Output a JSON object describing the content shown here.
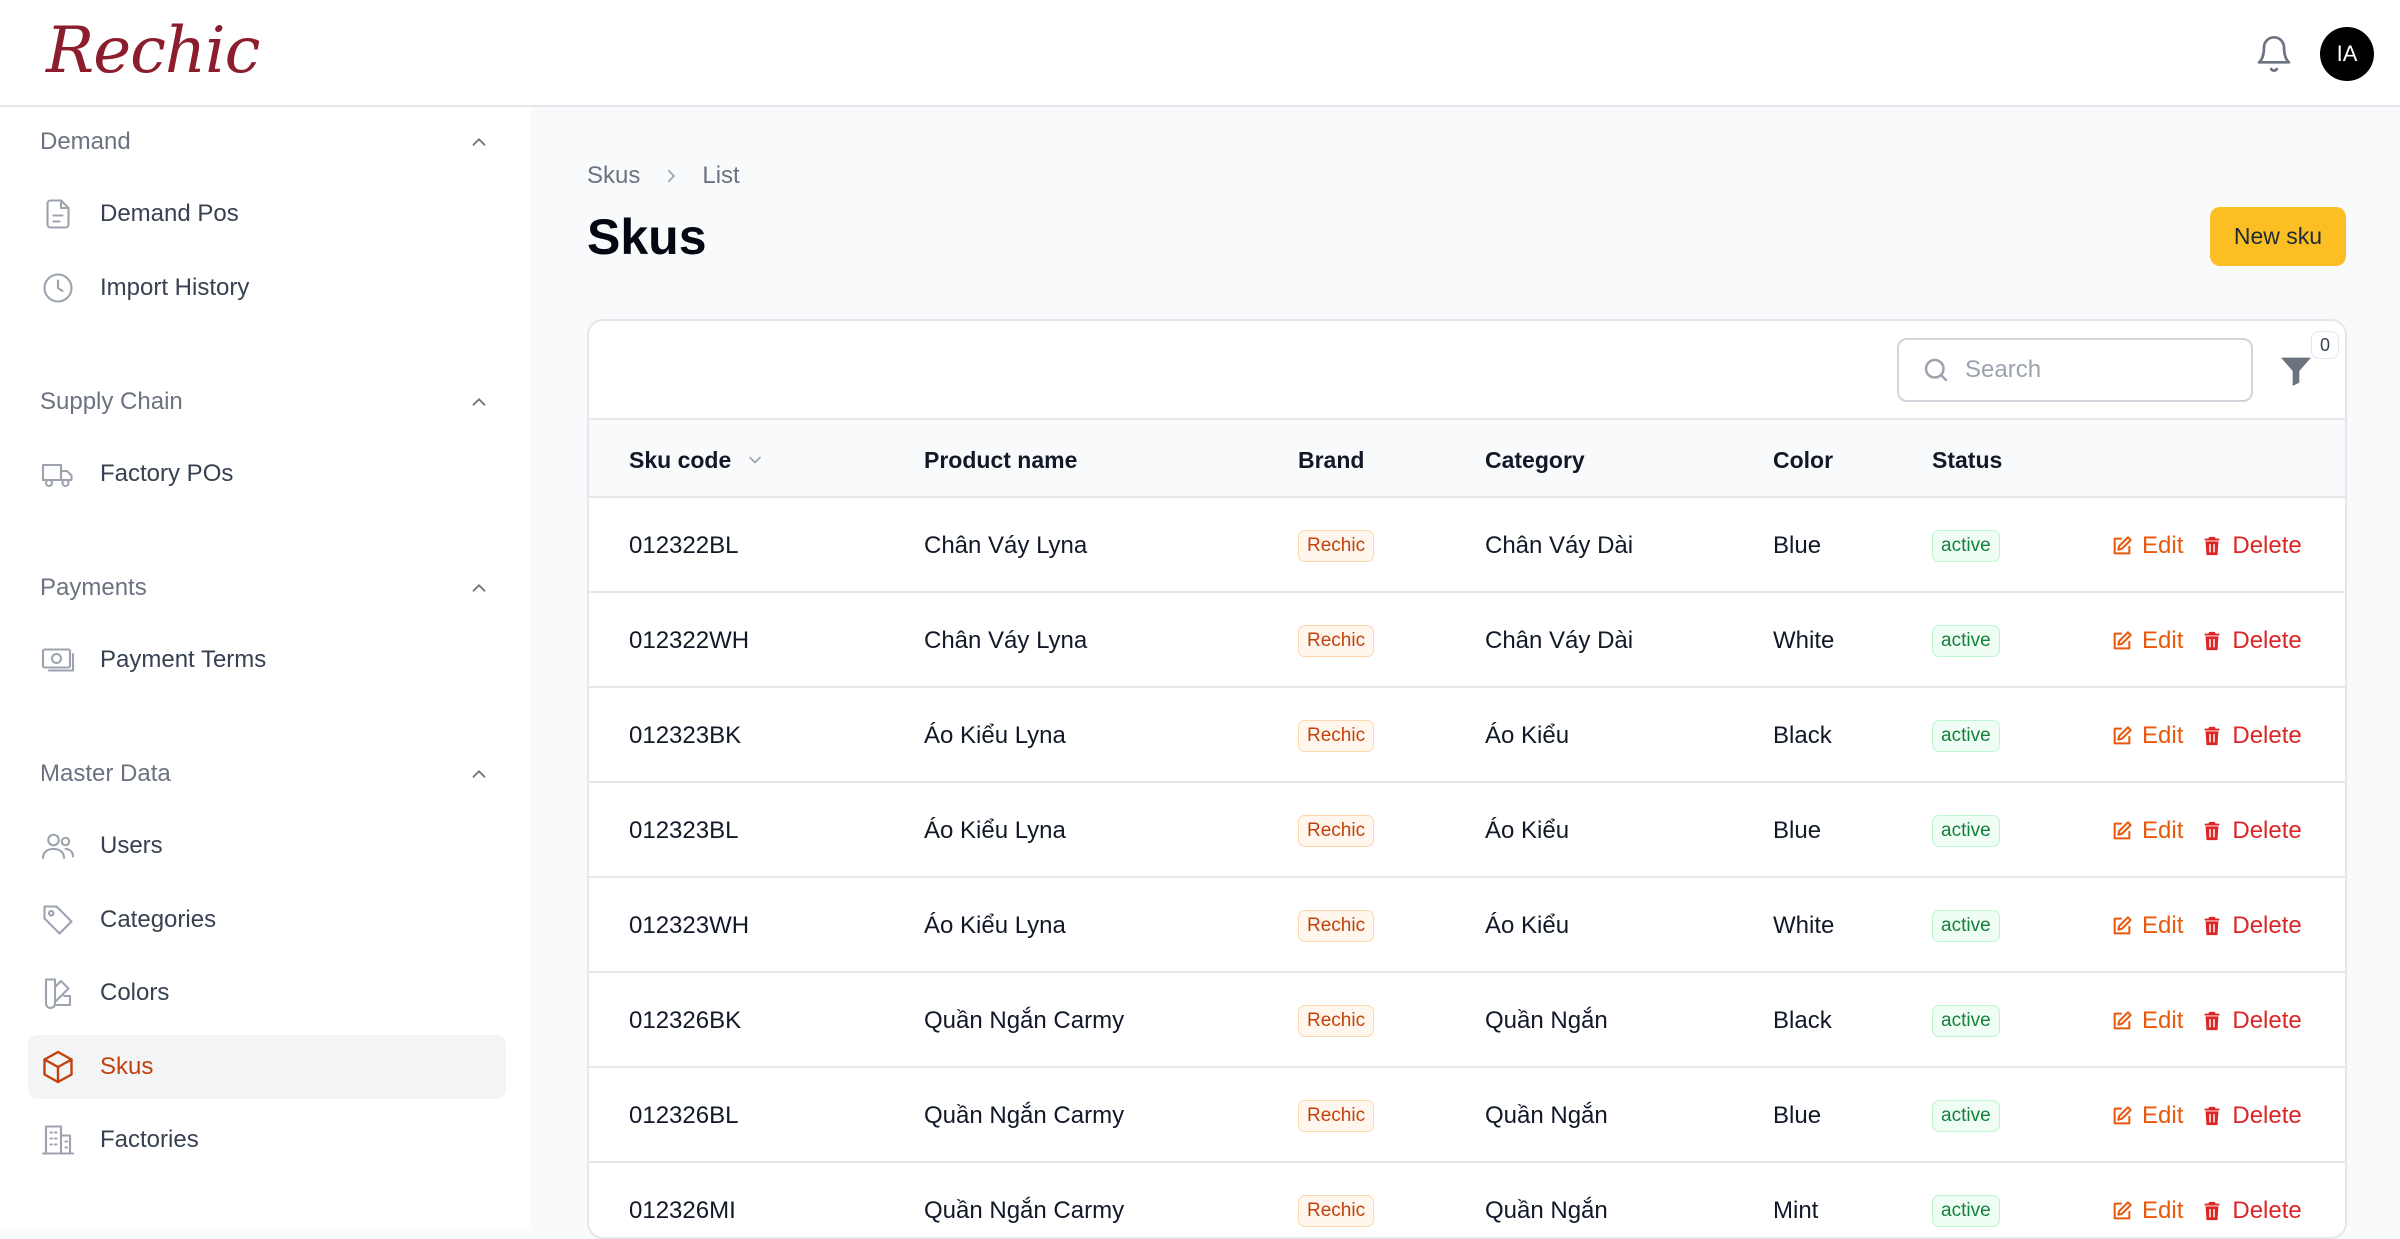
{
  "app": {
    "logo": "Rechic",
    "avatar_initials": "IA"
  },
  "sidebar": {
    "groups": [
      {
        "label": "Demand",
        "items": [
          {
            "label": "Demand Pos",
            "icon": "document-icon"
          },
          {
            "label": "Import History",
            "icon": "clock-icon"
          }
        ]
      },
      {
        "label": "Supply Chain",
        "items": [
          {
            "label": "Factory POs",
            "icon": "truck-icon"
          }
        ]
      },
      {
        "label": "Payments",
        "items": [
          {
            "label": "Payment Terms",
            "icon": "banknote-icon"
          }
        ]
      },
      {
        "label": "Master Data",
        "items": [
          {
            "label": "Users",
            "icon": "users-icon"
          },
          {
            "label": "Categories",
            "icon": "tag-icon"
          },
          {
            "label": "Colors",
            "icon": "swatch-icon"
          },
          {
            "label": "Skus",
            "icon": "cube-icon",
            "active": true
          },
          {
            "label": "Factories",
            "icon": "building-icon"
          }
        ]
      }
    ]
  },
  "breadcrumb": {
    "first": "Skus",
    "second": "List"
  },
  "page": {
    "title": "Skus",
    "new_button": "New sku"
  },
  "toolbar": {
    "search_placeholder": "Search",
    "filter_count": "0"
  },
  "table": {
    "columns": [
      "Sku code",
      "Product name",
      "Brand",
      "Category",
      "Color",
      "Status"
    ],
    "edit_label": "Edit",
    "delete_label": "Delete",
    "rows": [
      {
        "sku": "012322BL",
        "product": "Chân Váy Lyna",
        "brand": "Rechic",
        "category": "Chân Váy Dài",
        "color": "Blue",
        "status": "active"
      },
      {
        "sku": "012322WH",
        "product": "Chân Váy Lyna",
        "brand": "Rechic",
        "category": "Chân Váy Dài",
        "color": "White",
        "status": "active"
      },
      {
        "sku": "012323BK",
        "product": "Áo Kiểu Lyna",
        "brand": "Rechic",
        "category": "Áo Kiểu",
        "color": "Black",
        "status": "active"
      },
      {
        "sku": "012323BL",
        "product": "Áo Kiểu Lyna",
        "brand": "Rechic",
        "category": "Áo Kiểu",
        "color": "Blue",
        "status": "active"
      },
      {
        "sku": "012323WH",
        "product": "Áo Kiểu Lyna",
        "brand": "Rechic",
        "category": "Áo Kiểu",
        "color": "White",
        "status": "active"
      },
      {
        "sku": "012326BK",
        "product": "Quần Ngắn Carmy",
        "brand": "Rechic",
        "category": "Quần Ngắn",
        "color": "Black",
        "status": "active"
      },
      {
        "sku": "012326BL",
        "product": "Quần Ngắn Carmy",
        "brand": "Rechic",
        "category": "Quần Ngắn",
        "color": "Blue",
        "status": "active"
      },
      {
        "sku": "012326MI",
        "product": "Quần Ngắn Carmy",
        "brand": "Rechic",
        "category": "Quần Ngắn",
        "color": "Mint",
        "status": "active"
      }
    ]
  }
}
